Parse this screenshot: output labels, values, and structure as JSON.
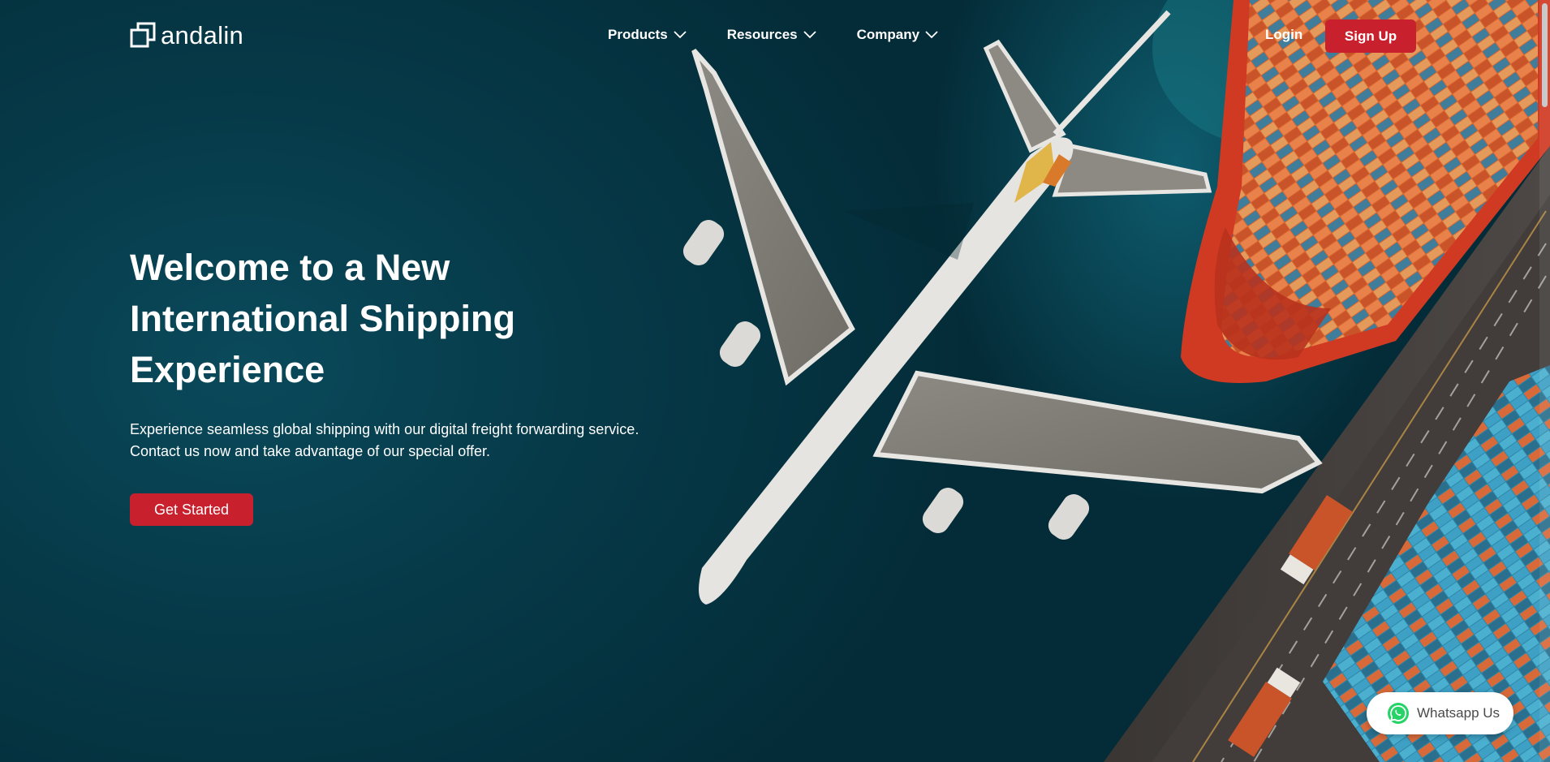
{
  "brand": {
    "name": "andalin",
    "icon": "layered-squares-logo"
  },
  "nav": {
    "items": [
      {
        "label": "Products",
        "icon": "chevron-down-icon"
      },
      {
        "label": "Resources",
        "icon": "chevron-down-icon"
      },
      {
        "label": "Company",
        "icon": "chevron-down-icon"
      }
    ],
    "login_label": "Login",
    "signup_label": "Sign Up"
  },
  "hero": {
    "title": "Welcome to a New International Shipping Experience",
    "description": "Experience seamless global shipping with our digital freight forwarding service. Contact us now and take advantage of our special offer.",
    "cta_label": "Get Started"
  },
  "whatsapp": {
    "label": "Whatsapp Us",
    "icon": "whatsapp-icon"
  },
  "colors": {
    "accent": "#c8202d",
    "ocean": "#06404f",
    "text": "#ffffff",
    "whatsapp_green": "#25d366"
  }
}
